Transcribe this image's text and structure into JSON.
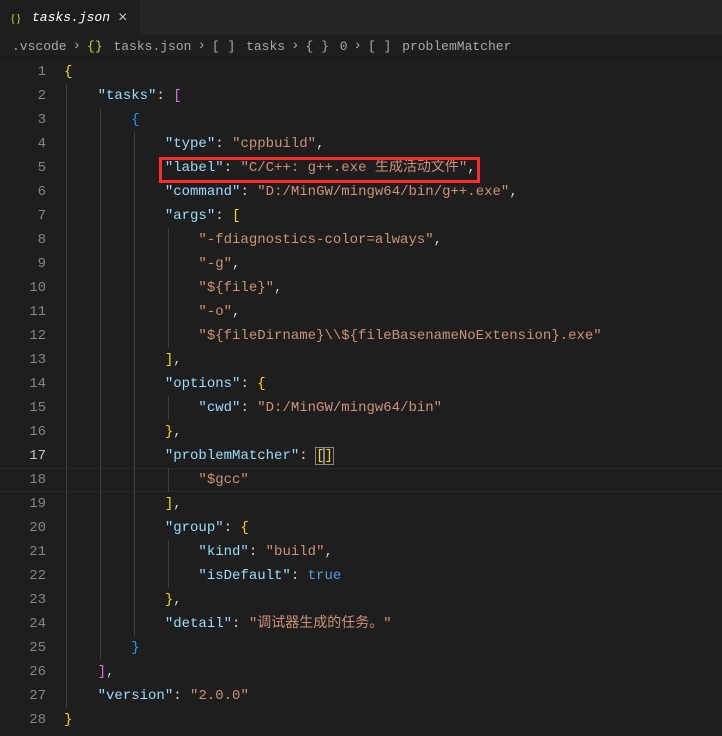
{
  "tab": {
    "label": "tasks.json",
    "icon": "json-icon"
  },
  "breadcrumbs": [
    {
      "icon": "",
      "label": ".vscode"
    },
    {
      "icon": "json",
      "label": "tasks.json"
    },
    {
      "icon": "array",
      "label": "tasks"
    },
    {
      "icon": "object",
      "label": "0"
    },
    {
      "icon": "array",
      "label": "problemMatcher"
    }
  ],
  "lineNumbers": [
    "1",
    "2",
    "3",
    "4",
    "5",
    "6",
    "7",
    "8",
    "9",
    "10",
    "11",
    "12",
    "13",
    "14",
    "15",
    "16",
    "17",
    "18",
    "19",
    "20",
    "21",
    "22",
    "23",
    "24",
    "25",
    "26",
    "27",
    "28"
  ],
  "activeLine": 17,
  "highlight": {
    "line": 5,
    "startCol": 4,
    "text": "\"label\": \"C/C++: g++.exe 生成活动文件\","
  },
  "code": {
    "l1": {
      "t": [
        {
          "c": "b",
          "v": "{"
        }
      ]
    },
    "l2": {
      "i": 1,
      "t": [
        {
          "c": "k",
          "v": "\"tasks\""
        },
        {
          "c": "p",
          "v": ": "
        },
        {
          "c": "b1",
          "v": "["
        }
      ]
    },
    "l3": {
      "i": 2,
      "t": [
        {
          "c": "b2",
          "v": "{"
        }
      ]
    },
    "l4": {
      "i": 3,
      "t": [
        {
          "c": "k",
          "v": "\"type\""
        },
        {
          "c": "p",
          "v": ": "
        },
        {
          "c": "s",
          "v": "\"cppbuild\""
        },
        {
          "c": "p",
          "v": ","
        }
      ]
    },
    "l5": {
      "i": 3,
      "t": [
        {
          "c": "k",
          "v": "\"label\""
        },
        {
          "c": "p",
          "v": ": "
        },
        {
          "c": "s",
          "v": "\"C/C++: g++.exe 生成活动文件\""
        },
        {
          "c": "p",
          "v": ","
        }
      ]
    },
    "l6": {
      "i": 3,
      "t": [
        {
          "c": "k",
          "v": "\"command\""
        },
        {
          "c": "p",
          "v": ": "
        },
        {
          "c": "s",
          "v": "\"D:/MinGW/mingw64/bin/g++.exe\""
        },
        {
          "c": "p",
          "v": ","
        }
      ]
    },
    "l7": {
      "i": 3,
      "t": [
        {
          "c": "k",
          "v": "\"args\""
        },
        {
          "c": "p",
          "v": ": "
        },
        {
          "c": "b3",
          "v": "["
        }
      ]
    },
    "l8": {
      "i": 4,
      "t": [
        {
          "c": "s",
          "v": "\"-fdiagnostics-color=always\""
        },
        {
          "c": "p",
          "v": ","
        }
      ]
    },
    "l9": {
      "i": 4,
      "t": [
        {
          "c": "s",
          "v": "\"-g\""
        },
        {
          "c": "p",
          "v": ","
        }
      ]
    },
    "l10": {
      "i": 4,
      "t": [
        {
          "c": "s",
          "v": "\"${file}\""
        },
        {
          "c": "p",
          "v": ","
        }
      ]
    },
    "l11": {
      "i": 4,
      "t": [
        {
          "c": "s",
          "v": "\"-o\""
        },
        {
          "c": "p",
          "v": ","
        }
      ]
    },
    "l12": {
      "i": 4,
      "t": [
        {
          "c": "s",
          "v": "\"${fileDirname}\\\\${fileBasenameNoExtension}.exe\""
        }
      ]
    },
    "l13": {
      "i": 3,
      "t": [
        {
          "c": "b3",
          "v": "]"
        },
        {
          "c": "p",
          "v": ","
        }
      ]
    },
    "l14": {
      "i": 3,
      "t": [
        {
          "c": "k",
          "v": "\"options\""
        },
        {
          "c": "p",
          "v": ": "
        },
        {
          "c": "b3",
          "v": "{"
        }
      ]
    },
    "l15": {
      "i": 4,
      "t": [
        {
          "c": "k",
          "v": "\"cwd\""
        },
        {
          "c": "p",
          "v": ": "
        },
        {
          "c": "s",
          "v": "\"D:/MinGW/mingw64/bin\""
        }
      ]
    },
    "l16": {
      "i": 3,
      "t": [
        {
          "c": "b3",
          "v": "}"
        },
        {
          "c": "p",
          "v": ","
        }
      ]
    },
    "l17": {
      "i": 3,
      "t": [
        {
          "c": "k",
          "v": "\"problemMatcher\""
        },
        {
          "c": "p",
          "v": ": "
        },
        {
          "c": "b3",
          "v": "[",
          "bm": true
        },
        {
          "c": "b3",
          "v": "]",
          "bm": true
        }
      ]
    },
    "l18": {
      "i": 4,
      "t": [
        {
          "c": "s",
          "v": "\"$gcc\""
        }
      ]
    },
    "l19": {
      "i": 3,
      "t": [
        {
          "c": "b3",
          "v": "]"
        },
        {
          "c": "p",
          "v": ","
        }
      ]
    },
    "l20": {
      "i": 3,
      "t": [
        {
          "c": "k",
          "v": "\"group\""
        },
        {
          "c": "p",
          "v": ": "
        },
        {
          "c": "b3",
          "v": "{"
        }
      ]
    },
    "l21": {
      "i": 4,
      "t": [
        {
          "c": "k",
          "v": "\"kind\""
        },
        {
          "c": "p",
          "v": ": "
        },
        {
          "c": "s",
          "v": "\"build\""
        },
        {
          "c": "p",
          "v": ","
        }
      ]
    },
    "l22": {
      "i": 4,
      "t": [
        {
          "c": "k",
          "v": "\"isDefault\""
        },
        {
          "c": "p",
          "v": ": "
        },
        {
          "c": "kw",
          "v": "true"
        }
      ]
    },
    "l23": {
      "i": 3,
      "t": [
        {
          "c": "b3",
          "v": "}"
        },
        {
          "c": "p",
          "v": ","
        }
      ]
    },
    "l24": {
      "i": 3,
      "t": [
        {
          "c": "k",
          "v": "\"detail\""
        },
        {
          "c": "p",
          "v": ": "
        },
        {
          "c": "s",
          "v": "\"调试器生成的任务。\""
        }
      ]
    },
    "l25": {
      "i": 2,
      "t": [
        {
          "c": "b2",
          "v": "}"
        }
      ]
    },
    "l26": {
      "i": 1,
      "t": [
        {
          "c": "b1",
          "v": "]"
        },
        {
          "c": "p",
          "v": ","
        }
      ]
    },
    "l27": {
      "i": 1,
      "t": [
        {
          "c": "k",
          "v": "\"version\""
        },
        {
          "c": "p",
          "v": ": "
        },
        {
          "c": "s",
          "v": "\"2.0.0\""
        }
      ]
    },
    "l28": {
      "t": [
        {
          "c": "b",
          "v": "}"
        }
      ]
    }
  }
}
